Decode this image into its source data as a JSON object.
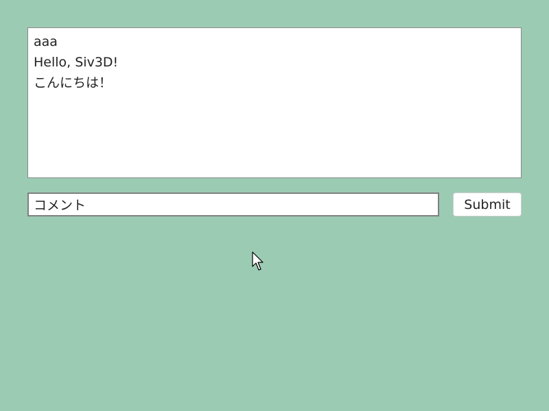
{
  "chat_log": {
    "lines": [
      "aaa",
      "Hello, Siv3D!",
      "こんにちは！"
    ]
  },
  "comment_field": {
    "value": "コメント"
  },
  "submit_button": {
    "label": "Submit"
  },
  "cursor": {
    "icon": "arrow-pointer-icon"
  },
  "colors": {
    "background": "#9ccbb3",
    "panel": "#ffffff",
    "border": "#8a8a8a",
    "text": "#222222"
  }
}
